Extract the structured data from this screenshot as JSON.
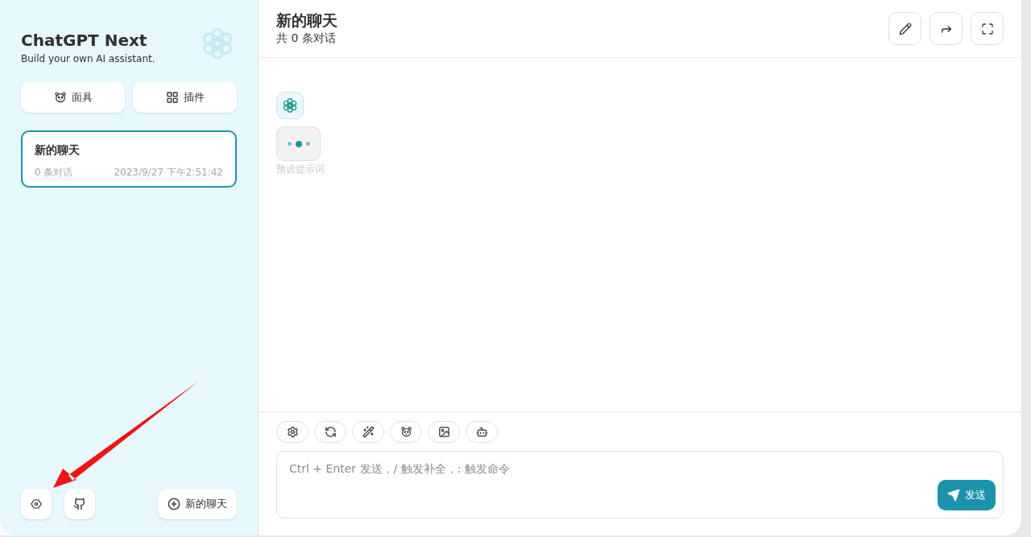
{
  "sidebar": {
    "title": "ChatGPT Next",
    "subtitle": "Build your own AI assistant.",
    "buttons": [
      {
        "kind": "mask",
        "label": "面具"
      },
      {
        "kind": "plugin",
        "label": "插件"
      }
    ],
    "chats": [
      {
        "title": "新的聊天",
        "count": "0 条对话",
        "time": "2023/9/27 下午2:51:42",
        "selected": true
      }
    ],
    "new_chat": "新的聊天"
  },
  "header": {
    "title": "新的聊天",
    "subtitle": "共 0 条对话"
  },
  "message": {
    "hint": "预设提示词"
  },
  "input": {
    "placeholder": "Ctrl + Enter 发送，/ 触发补全，: 触发命令",
    "send": "发送"
  }
}
